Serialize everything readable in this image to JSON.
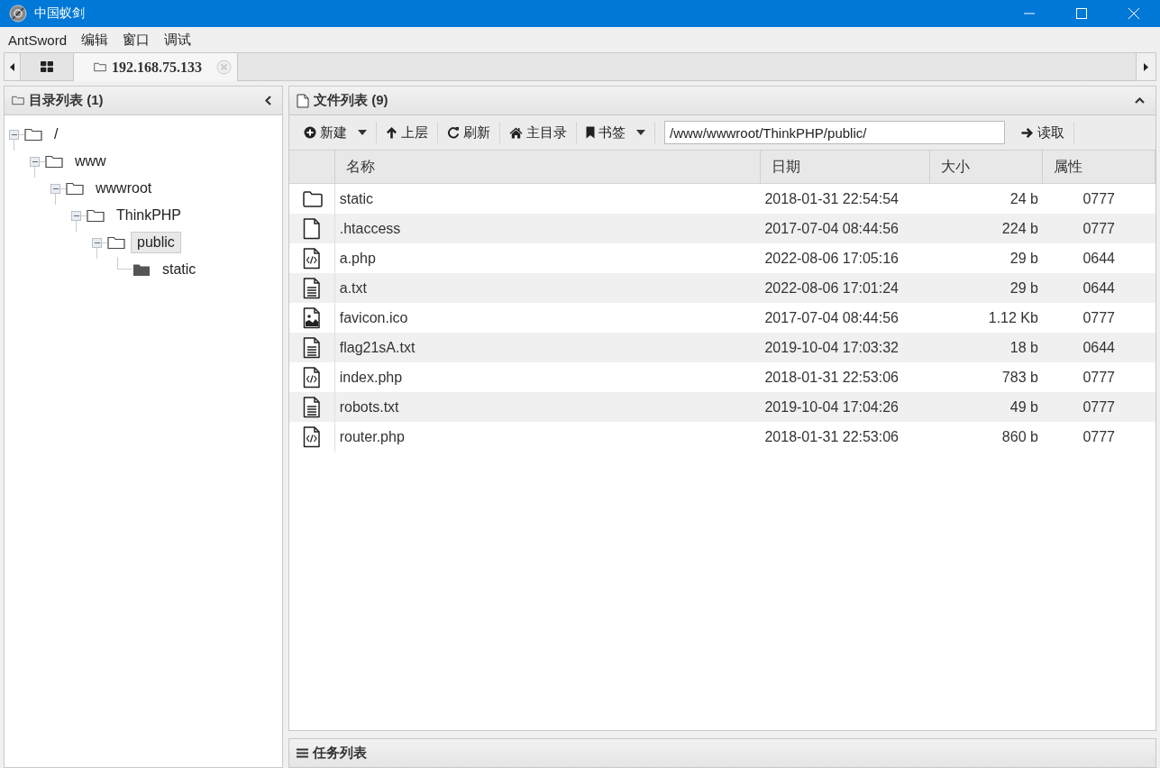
{
  "window": {
    "title": "中国蚁剑"
  },
  "menu": [
    "AntSword",
    "编辑",
    "窗口",
    "调试"
  ],
  "tabs": [
    {
      "kind": "home",
      "selected": false
    },
    {
      "kind": "host",
      "label": "192.168.75.133",
      "selected": true
    }
  ],
  "directory_panel": {
    "title": "目录列表 (1)",
    "tree": [
      {
        "name": "/",
        "expanded": true,
        "selected": false,
        "children": [
          {
            "name": "www",
            "expanded": true,
            "selected": false,
            "children": [
              {
                "name": "wwwroot",
                "expanded": true,
                "selected": false,
                "children": [
                  {
                    "name": "ThinkPHP",
                    "expanded": true,
                    "selected": false,
                    "children": [
                      {
                        "name": "public",
                        "expanded": true,
                        "selected": true,
                        "children": [
                          {
                            "name": "static",
                            "expanded": false,
                            "selected": false
                          }
                        ]
                      }
                    ]
                  }
                ]
              }
            ]
          }
        ]
      }
    ]
  },
  "file_panel": {
    "title": "文件列表 (9)",
    "toolbar": [
      {
        "kind": "plus",
        "label": "新建",
        "dropdown": true
      },
      {
        "kind": "up",
        "label": "上层",
        "dropdown": false
      },
      {
        "kind": "refresh",
        "label": "刷新",
        "dropdown": false
      },
      {
        "kind": "home",
        "label": "主目录",
        "dropdown": false
      },
      {
        "kind": "bookmark",
        "label": "书签",
        "dropdown": true
      }
    ],
    "path": "/www/wwwroot/ThinkPHP/public/",
    "read_button": "读取",
    "columns": [
      "名称",
      "日期",
      "大小",
      "属性"
    ],
    "rows": [
      {
        "kind": "folder",
        "name": "static",
        "date": "2018-01-31 22:54:54",
        "size": "24 b",
        "attributes": "0777"
      },
      {
        "kind": "file",
        "name": ".htaccess",
        "date": "2017-07-04 08:44:56",
        "size": "224 b",
        "attributes": "0777"
      },
      {
        "kind": "code",
        "name": "a.php",
        "date": "2022-08-06 17:05:16",
        "size": "29 b",
        "attributes": "0644"
      },
      {
        "kind": "text",
        "name": "a.txt",
        "date": "2022-08-06 17:01:24",
        "size": "29 b",
        "attributes": "0644"
      },
      {
        "kind": "image",
        "name": "favicon.ico",
        "date": "2017-07-04 08:44:56",
        "size": "1.12 Kb",
        "attributes": "0777"
      },
      {
        "kind": "text",
        "name": "flag21sA.txt",
        "date": "2019-10-04 17:03:32",
        "size": "18 b",
        "attributes": "0644"
      },
      {
        "kind": "code",
        "name": "index.php",
        "date": "2018-01-31 22:53:06",
        "size": "783 b",
        "attributes": "0777"
      },
      {
        "kind": "text",
        "name": "robots.txt",
        "date": "2019-10-04 17:04:26",
        "size": "49 b",
        "attributes": "0777"
      },
      {
        "kind": "code",
        "name": "router.php",
        "date": "2018-01-31 22:53:06",
        "size": "860 b",
        "attributes": "0777"
      }
    ]
  },
  "task_panel": {
    "title": "任务列表"
  }
}
